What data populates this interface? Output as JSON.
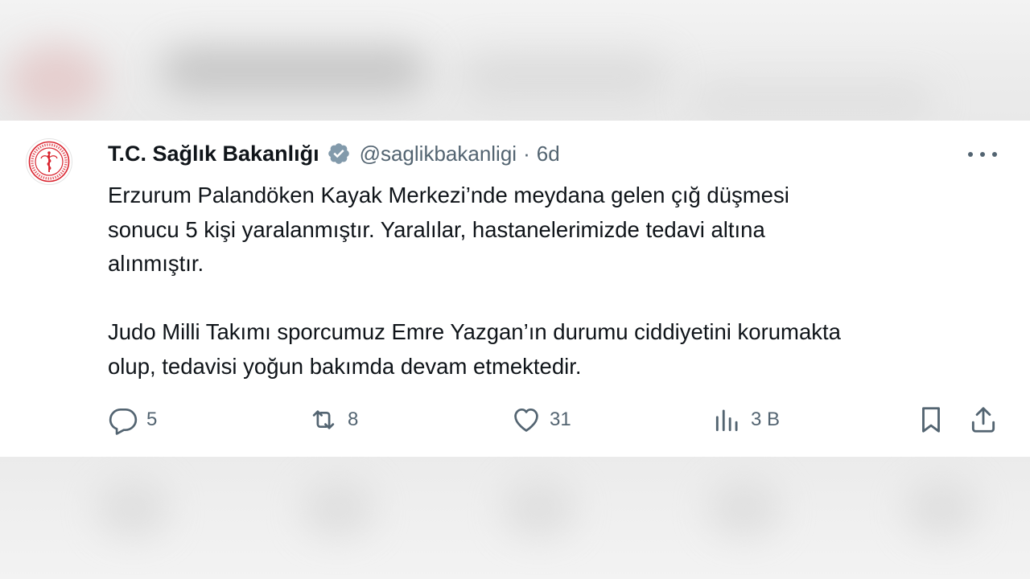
{
  "tweet": {
    "author_name": "T.C. Sağlık Bakanlığı",
    "handle": "@saglikbakanligi",
    "separator": "·",
    "time": "6d",
    "lines_paragraph_1": [
      "Erzurum Palandöken Kayak Merkezi’nde meydana gelen çığ düşmesi",
      "sonucu 5 kişi yaralanmıştır. Yaralılar, hastanelerimizde tedavi altına",
      "alınmıştır."
    ],
    "lines_paragraph_2": [
      "Judo Milli Takımı sporcumuz Emre Yazgan’ın durumu ciddiyetini korumakta",
      "olup, tedavisi yoğun bakımda devam etmektedir."
    ]
  },
  "actions": {
    "replies": "5",
    "reposts": "8",
    "likes": "31",
    "views": "3 B"
  },
  "icons": {
    "verified": "verified-badge-icon",
    "more": "more-dots-icon",
    "reply": "reply-icon",
    "repost": "repost-icon",
    "like": "heart-icon",
    "views": "views-chart-icon",
    "bookmark": "bookmark-icon",
    "share": "share-icon"
  },
  "colors": {
    "text": "#0f1419",
    "secondary": "#536471",
    "verified_badge": "#829aab",
    "logo_red": "#d9232e"
  }
}
